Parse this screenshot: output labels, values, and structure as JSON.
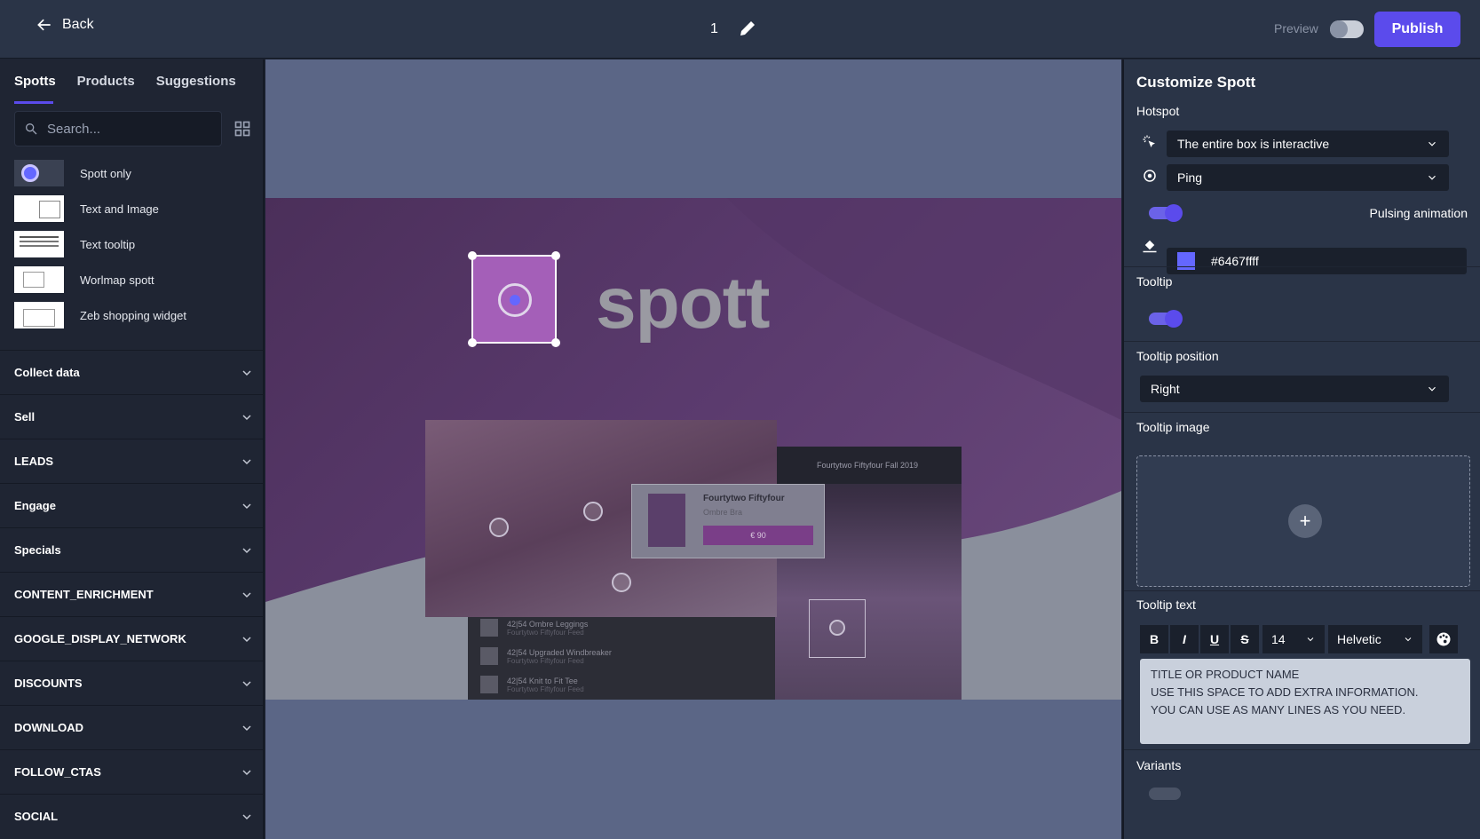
{
  "topbar": {
    "back_label": "Back",
    "page_number": "1",
    "preview_label": "Preview",
    "publish_label": "Publish"
  },
  "left": {
    "tabs": [
      {
        "label": "Spotts"
      },
      {
        "label": "Products"
      },
      {
        "label": "Suggestions"
      }
    ],
    "search_placeholder": "Search...",
    "templates": [
      {
        "label": "Spott only"
      },
      {
        "label": "Text and Image"
      },
      {
        "label": "Text tooltip"
      },
      {
        "label": "Worlmap spott"
      },
      {
        "label": "Zeb shopping widget"
      }
    ],
    "sections": [
      {
        "label": "Collect data"
      },
      {
        "label": "Sell"
      },
      {
        "label": "LEADS"
      },
      {
        "label": "Engage"
      },
      {
        "label": "Specials"
      },
      {
        "label": "CONTENT_ENRICHMENT"
      },
      {
        "label": "GOOGLE_DISPLAY_NETWORK"
      },
      {
        "label": "DISCOUNTS"
      },
      {
        "label": "DOWNLOAD"
      },
      {
        "label": "FOLLOW_CTAS"
      },
      {
        "label": "SOCIAL"
      }
    ]
  },
  "canvas": {
    "logo_text": "spott",
    "product_name": "Fourtytwo Fiftyfour",
    "product_sub": "Ombre Bra",
    "product_price": "€ 90",
    "collection_header": "Fourtytwo Fiftyfour Fall 2019",
    "list_items": [
      {
        "title": "42|54 Ombre Leggings",
        "sub": "Fourtytwo Fiftyfour Feed"
      },
      {
        "title": "42|54 Upgraded Windbreaker",
        "sub": "Fourtytwo Fiftyfour Feed"
      },
      {
        "title": "42|54 Knit to Fit Tee",
        "sub": "Fourtytwo Fiftyfour Feed"
      }
    ]
  },
  "right": {
    "title": "Customize Spott",
    "hotspot_label": "Hotspot",
    "interaction_value": "The entire box is interactive",
    "animation_value": "Ping",
    "pulsing_label": "Pulsing animation",
    "color_value": "#6467ffff",
    "tooltip_label": "Tooltip",
    "tooltip_position_label": "Tooltip position",
    "tooltip_position_value": "Right",
    "tooltip_image_label": "Tooltip image",
    "tooltip_text_label": "Tooltip text",
    "font_size_value": "14",
    "font_family_value": "Helvetic",
    "format_buttons": {
      "bold": "B",
      "italic": "I",
      "underline": "U",
      "strike": "S"
    },
    "tooltip_text_lines": [
      "TITLE OR PRODUCT NAME",
      "USE THIS SPACE TO ADD EXTRA INFORMATION.",
      "YOU CAN USE AS MANY LINES AS YOU NEED."
    ],
    "variants_label": "Variants"
  },
  "colors": {
    "accent": "#5b4bec",
    "hotspot": "#6467ff"
  }
}
